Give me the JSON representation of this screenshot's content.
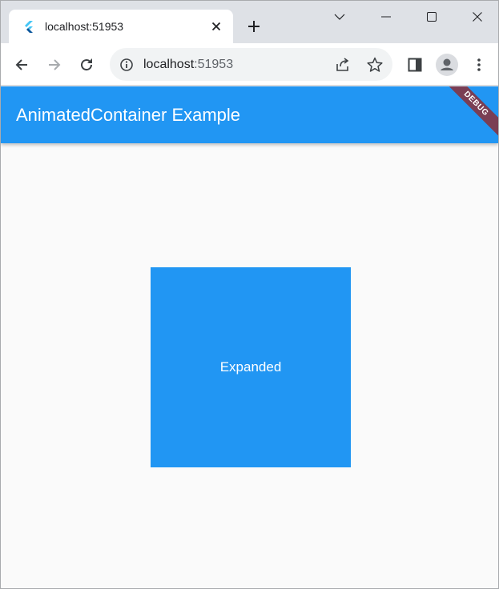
{
  "browser": {
    "tab": {
      "title": "localhost:51953"
    },
    "omnibox": {
      "host": "localhost",
      "port": ":51953"
    }
  },
  "app": {
    "appbar_title": "AnimatedContainer Example",
    "debug_banner": "DEBUG",
    "box": {
      "label": "Expanded",
      "color": "#2196f3"
    }
  },
  "colors": {
    "accent": "#2196f3",
    "page_background": "#fafafa",
    "tabstrip": "#dee1e6"
  },
  "icons": {
    "favicon": "flutter-icon",
    "tab_close": "close-icon",
    "new_tab": "plus-icon",
    "back": "arrow-left-icon",
    "forward": "arrow-right-icon",
    "reload": "reload-icon",
    "info": "info-icon",
    "share": "share-icon",
    "bookmark": "star-icon",
    "side_panel": "side-panel-icon",
    "profile": "profile-icon",
    "menu": "kebab-menu-icon"
  }
}
